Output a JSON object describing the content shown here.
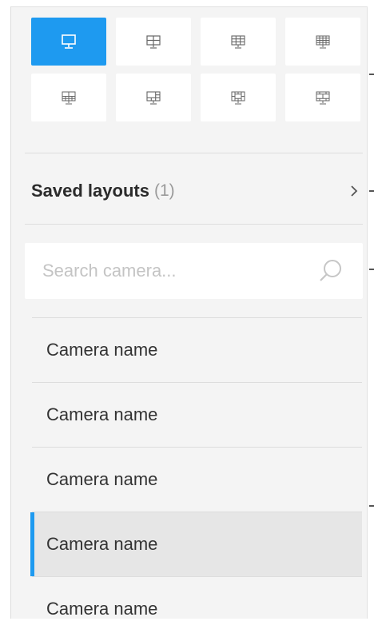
{
  "accent_color": "#1e9af0",
  "layouts": [
    {
      "icon": "monitor-icon",
      "selected": true
    },
    {
      "icon": "layout-2x2-icon",
      "selected": false
    },
    {
      "icon": "layout-3x3-icon",
      "selected": false
    },
    {
      "icon": "layout-4x4-icon",
      "selected": false
    },
    {
      "icon": "layout-1-plus-7-icon",
      "selected": false
    },
    {
      "icon": "layout-1-plus-5-icon",
      "selected": false
    },
    {
      "icon": "layout-1-plus-12-icon",
      "selected": false
    },
    {
      "icon": "layout-2-plus-8-icon",
      "selected": false
    }
  ],
  "saved_layouts": {
    "title": "Saved layouts",
    "count": "(1)"
  },
  "search": {
    "placeholder": "Search camera...",
    "value": ""
  },
  "cameras": [
    {
      "name": "Camera name",
      "selected": false
    },
    {
      "name": "Camera name",
      "selected": false
    },
    {
      "name": "Camera name",
      "selected": false
    },
    {
      "name": "Camera name",
      "selected": true
    },
    {
      "name": "Camera name",
      "selected": false
    }
  ]
}
